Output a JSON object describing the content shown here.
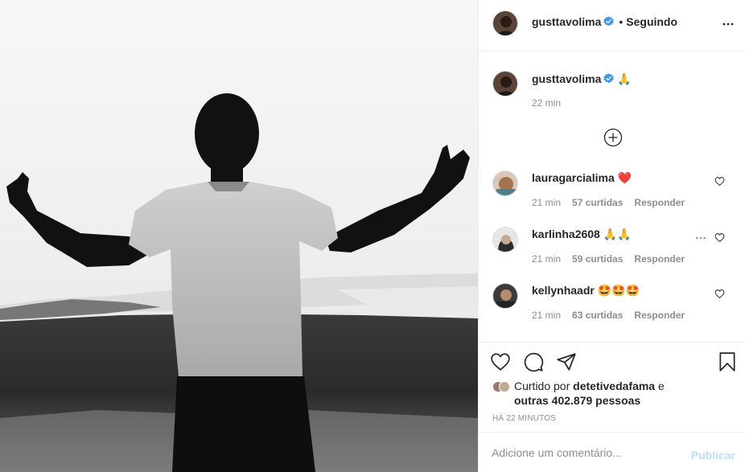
{
  "header": {
    "username": "gusttavolima",
    "follow_status": "Seguindo",
    "separator": "•"
  },
  "caption": {
    "username": "gusttavolima",
    "text": "🙏",
    "time": "22 min"
  },
  "comments": [
    {
      "username": "lauragarcialima",
      "text": "❤️",
      "time": "21 min",
      "likes": "57 curtidas",
      "reply": "Responder"
    },
    {
      "username": "karlinha2608",
      "text": "🙏🙏",
      "time": "21 min",
      "likes": "59 curtidas",
      "reply": "Responder"
    },
    {
      "username": "kellynhaadr",
      "text": "🤩🤩🤩",
      "time": "21 min",
      "likes": "63 curtidas",
      "reply": "Responder"
    }
  ],
  "likes": {
    "prefix": "Curtido por ",
    "user": "detetivedafama",
    "suffix": " e",
    "others": "outras 402.879 pessoas"
  },
  "timestamp": "HÁ 22 MINUTOS",
  "comment_input": {
    "placeholder": "Adicione um comentário..."
  },
  "publish_label": "Publicar",
  "icons": {
    "verified": "verified-badge-icon",
    "more": "more-options-icon",
    "add": "plus-circle-icon",
    "like": "heart-icon",
    "comment": "comment-bubble-icon",
    "share": "paper-plane-icon",
    "save": "bookmark-icon"
  },
  "colors": {
    "verified_blue": "#3897f0",
    "text": "#262626",
    "muted": "#8e8e8e",
    "publish_disabled": "#b9dffc",
    "heart_red": "#e0245e"
  }
}
